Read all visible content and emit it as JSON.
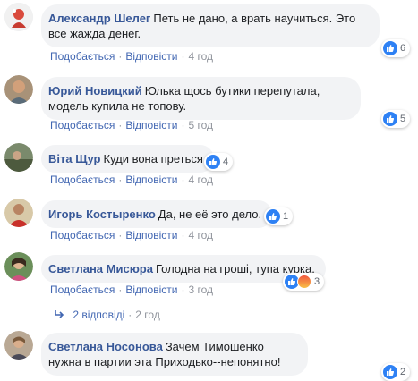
{
  "actions": {
    "like_label": "Подобається",
    "reply_label": "Відповісти",
    "separator": "·"
  },
  "comments": [
    {
      "author": "Александр Шелег",
      "text": "Петь не дано, а врать научиться. Это все жажда денег.",
      "time": "4 год",
      "reactions": {
        "count": "6",
        "types": [
          "like"
        ]
      }
    },
    {
      "author": "Юрий Новицкий",
      "text": "Юлька щось бутики перепутала, модель купила не топову.",
      "time": "5 год",
      "reactions": {
        "count": "5",
        "types": [
          "like"
        ]
      }
    },
    {
      "author": "Віта Щур",
      "text": "Куди вона преться",
      "time": "4 год",
      "reactions": {
        "count": "4",
        "types": [
          "like"
        ]
      }
    },
    {
      "author": "Игорь Костыренко",
      "text": "Да, не её это дело.",
      "time": "4 год",
      "reactions": {
        "count": "1",
        "types": [
          "like"
        ]
      }
    },
    {
      "author": "Светлана Мисюра",
      "text": "Голодна на гроші, тупа курка.",
      "time": "3 год",
      "reactions": {
        "count": "3",
        "types": [
          "like",
          "angry"
        ]
      }
    },
    {
      "author": "Светлана Носонова",
      "text": "Зачем Тимошенко нужна в партии эта Приходько--непонятно!",
      "time": "",
      "reactions": {
        "count": "2",
        "types": [
          "like"
        ]
      }
    }
  ],
  "replies_link": {
    "label": "2 відповіді",
    "time": "2 год"
  },
  "colors": {
    "author": "#385898",
    "link": "#4267b2",
    "meta": "#90949c",
    "bubble": "#f2f3f5",
    "like": "#2e81f4"
  }
}
